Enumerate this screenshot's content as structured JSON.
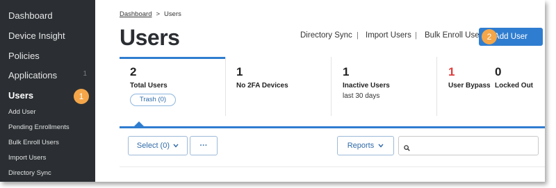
{
  "sidebar": {
    "items": [
      {
        "label": "Dashboard"
      },
      {
        "label": "Device Insight"
      },
      {
        "label": "Policies"
      },
      {
        "label": "Applications",
        "count": "1"
      },
      {
        "label": "Users"
      }
    ],
    "subitems": [
      {
        "label": "Add User"
      },
      {
        "label": "Pending Enrollments"
      },
      {
        "label": "Bulk Enroll Users"
      },
      {
        "label": "Import Users"
      },
      {
        "label": "Directory Sync"
      }
    ]
  },
  "breadcrumb": {
    "parent": "Dashboard",
    "separator": ">",
    "current": "Users"
  },
  "page_title": "Users",
  "header_links": {
    "directory_sync": "Directory Sync",
    "import_users": "Import Users",
    "bulk_enroll": "Bulk Enroll Users",
    "separator": "|"
  },
  "add_user_button": "Add User",
  "callouts": {
    "one": "1",
    "two": "2"
  },
  "stats": [
    {
      "number": "2",
      "label": "Total Users",
      "sub": "Trash (0)"
    },
    {
      "number": "1",
      "label": "No 2FA Devices"
    },
    {
      "number": "1",
      "label": "Inactive Users",
      "sub": "last 30 days"
    },
    {
      "number": "1",
      "label": "User Bypass"
    },
    {
      "number": "0",
      "label": "Locked Out"
    }
  ],
  "toolbar": {
    "select_label": "Select (0)",
    "more_label": "···",
    "reports_label": "Reports"
  },
  "colors": {
    "accent": "#2f7dd0",
    "callout": "#f4a649",
    "sidebar": "#2b2f33",
    "alert": "#e03c3c"
  }
}
